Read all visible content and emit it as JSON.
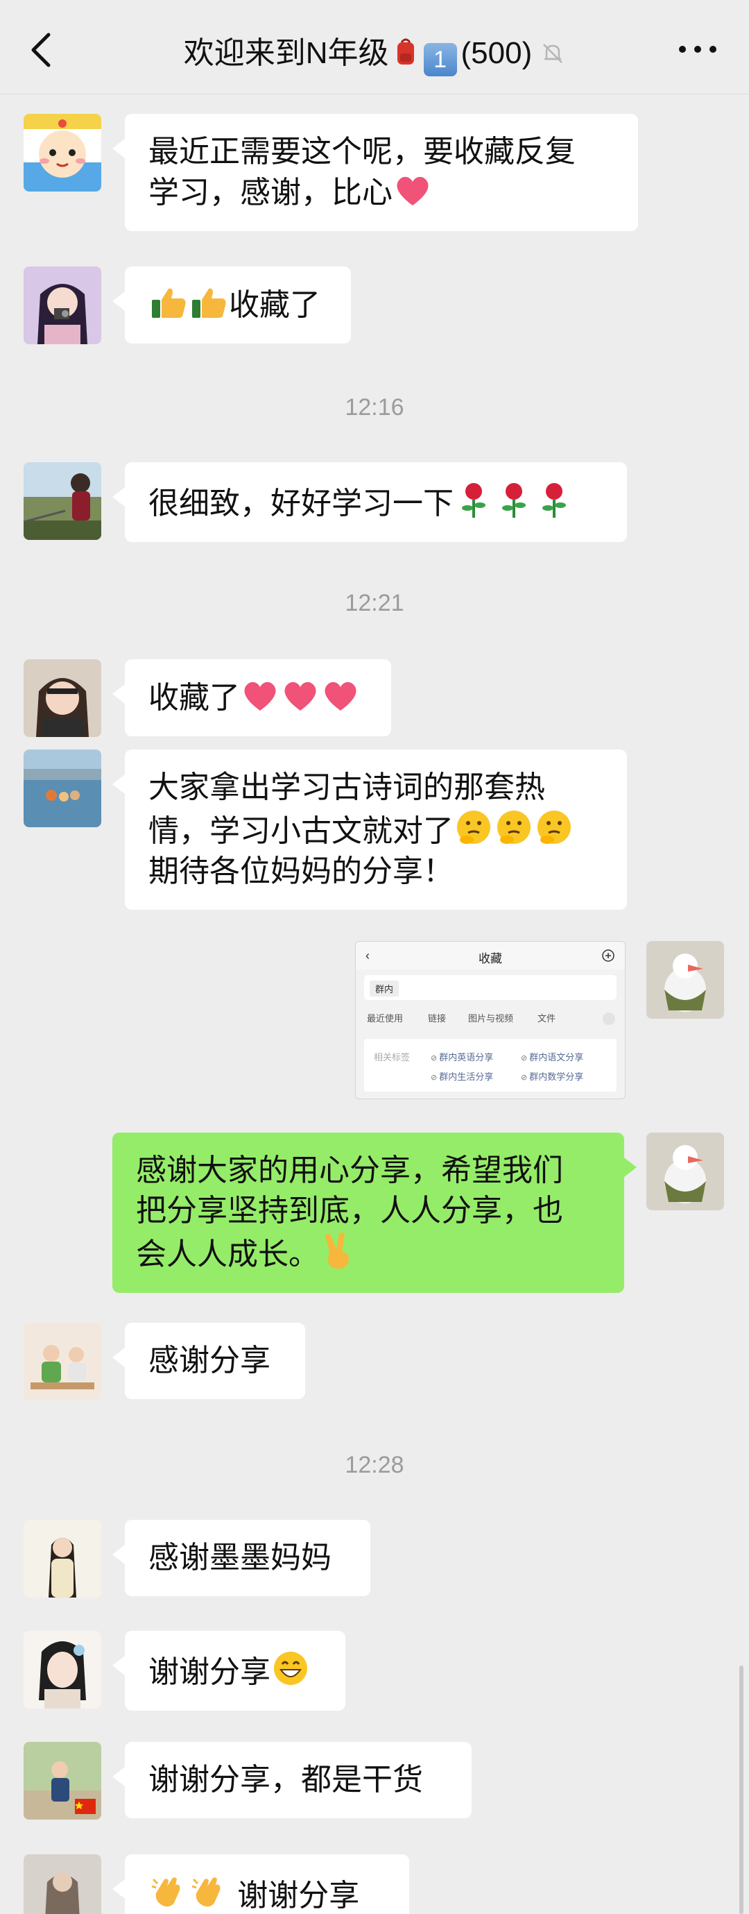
{
  "header": {
    "title_prefix": "欢迎来到N年级",
    "title_digit": "1",
    "member_count": "(500)"
  },
  "messages": {
    "m1": {
      "line1": "最近正需要这个呢，要收藏反复",
      "line2": "学习，感谢，比心"
    },
    "m2": {
      "text": "收藏了"
    },
    "m3": {
      "text": "很细致，好好学习一下"
    },
    "m4": {
      "text": "收藏了"
    },
    "m5": {
      "line1": "大家拿出学习古诗词的那套热",
      "line2": "情，学习小古文就对了",
      "line3": "期待各位妈妈的分享！"
    },
    "m6": {
      "line1": "感谢大家的用心分享，希望我们",
      "line2": "把分享坚持到底，人人分享，也",
      "line3": "会人人成长。"
    },
    "m7": {
      "text": "感谢分享"
    },
    "m8": {
      "text": "感谢墨墨妈妈"
    },
    "m9": {
      "text": "谢谢分享"
    },
    "m10": {
      "text": "谢谢分享，都是干货"
    },
    "m11": {
      "text": "谢谢分享"
    }
  },
  "timestamps": {
    "t1": "12:16",
    "t2": "12:21",
    "t3": "12:28"
  },
  "shared_image": {
    "title": "收藏",
    "chip": "群内",
    "tabs": [
      "最近使用",
      "链接",
      "图片与视频",
      "文件"
    ],
    "label": "相关标签",
    "tags": [
      "群内英语分享",
      "群内语文分享",
      "群内生活分享",
      "群内数学分享"
    ]
  },
  "colors": {
    "background": "#ededed",
    "bubble_in": "#ffffff",
    "bubble_out": "#95ec69",
    "timestamp": "#9b9b9b"
  },
  "icons": {
    "back": "chevron-left-icon",
    "bag": "backpack-icon",
    "mute": "bell-slash-icon",
    "more": "ellipsis-icon",
    "heart": "heart-emoji",
    "thumbs": "thumbs-up-emoji",
    "rose": "rose-emoji",
    "thinking": "thinking-face-emoji",
    "victory": "victory-hand-emoji",
    "grin": "grinning-face-emoji",
    "clap": "clapping-hands-emoji"
  }
}
